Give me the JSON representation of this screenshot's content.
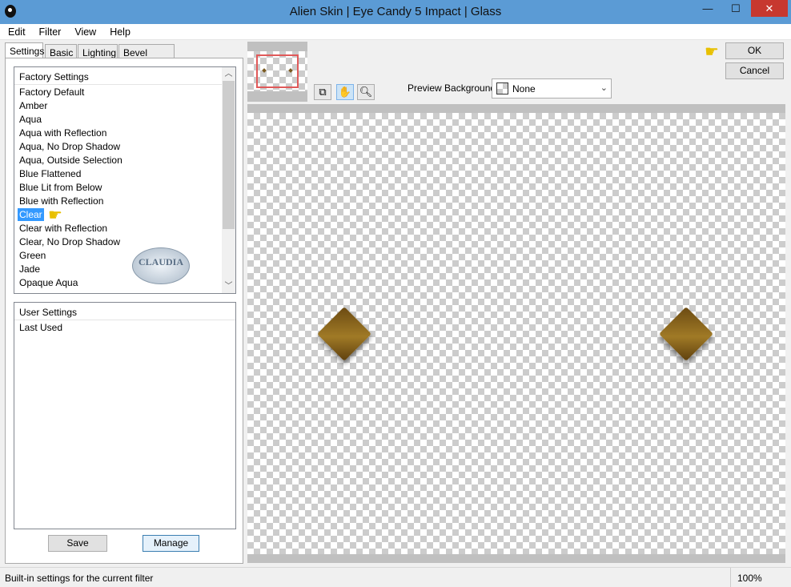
{
  "window": {
    "title": "Alien Skin | Eye Candy 5 Impact | Glass",
    "minimize": "—",
    "maximize": "☐",
    "close": "✕"
  },
  "menu": [
    "Edit",
    "Filter",
    "View",
    "Help"
  ],
  "tabs": [
    "Settings",
    "Basic",
    "Lighting",
    "Bevel Profile"
  ],
  "factory": {
    "header": "Factory Settings",
    "items": [
      "Factory Default",
      "Amber",
      "Aqua",
      "Aqua with Reflection",
      "Aqua, No Drop Shadow",
      "Aqua, Outside Selection",
      "Blue Flattened",
      "Blue Lit from Below",
      "Blue with Reflection",
      "Clear",
      "Clear with Reflection",
      "Clear, No Drop Shadow",
      "Green",
      "Jade",
      "Opaque Aqua"
    ],
    "selected": "Clear"
  },
  "user": {
    "header": "User Settings",
    "items": [
      "Last Used"
    ]
  },
  "buttons": {
    "save": "Save",
    "manage": "Manage",
    "ok": "OK",
    "cancel": "Cancel"
  },
  "preview_bg": {
    "label": "Preview Background:",
    "value": "None"
  },
  "watermark": "CLAUDIA",
  "status": {
    "text": "Built-in settings for the current filter",
    "zoom": "100%"
  },
  "colors": {
    "titlebar": "#5b9bd5",
    "selection": "#3399ff",
    "glass": "#8a6419"
  }
}
